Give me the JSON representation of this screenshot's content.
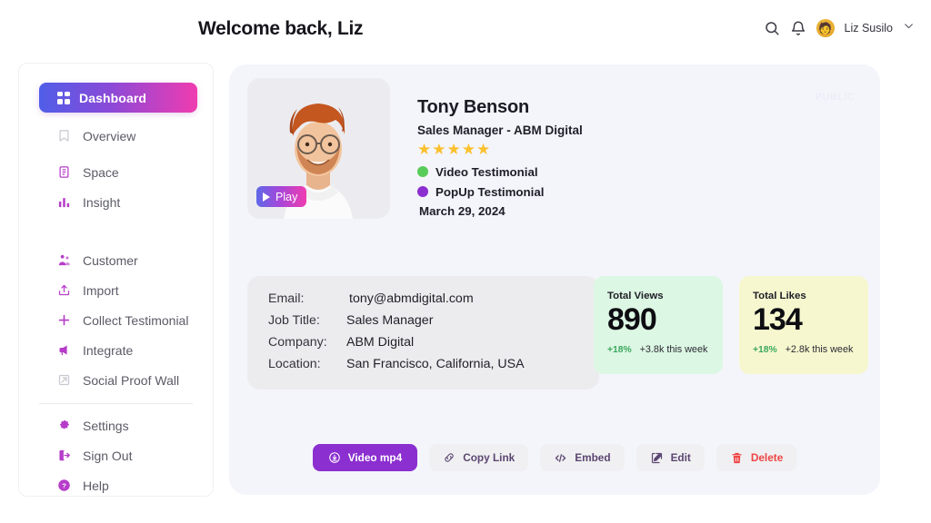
{
  "header": {
    "title": "Welcome back, Liz",
    "search_icon": "search-icon",
    "bell_icon": "bell-icon",
    "user_name": "Liz Susilo",
    "avatar_glyph": "🧑",
    "chevron_icon": "chevron-down-icon"
  },
  "sidebar": {
    "active": {
      "label": "Dashboard",
      "icon": "grid-icon"
    },
    "group1": [
      {
        "label": "Overview",
        "icon": "bookmark-icon"
      },
      {
        "label": "Space",
        "icon": "book-icon"
      },
      {
        "label": "Insight",
        "icon": "bar-chart-icon"
      }
    ],
    "group2": [
      {
        "label": "Customer",
        "icon": "users-icon"
      },
      {
        "label": "Import",
        "icon": "import-icon"
      },
      {
        "label": "Collect Testimonial",
        "icon": "plus-icon"
      },
      {
        "label": "Integrate",
        "icon": "megaphone-icon"
      },
      {
        "label": "Social Proof Wall",
        "icon": "external-link-icon"
      }
    ],
    "group3": [
      {
        "label": "Settings",
        "icon": "gear-icon"
      },
      {
        "label": "Sign Out",
        "icon": "logout-icon"
      },
      {
        "label": "Help",
        "icon": "help-circle-icon"
      }
    ]
  },
  "profile": {
    "ghost_badge": "PUBLIC",
    "play_label": "Play",
    "play_icon": "play-icon",
    "name": "Tony Benson",
    "role": "Sales Manager - ABM Digital",
    "stars": "★★★★★",
    "rating": 5,
    "badges": [
      {
        "label": "Video Testimonial",
        "color": "#58cc58"
      },
      {
        "label": "PopUp Testimonial",
        "color": "#8b2fd0"
      }
    ],
    "date": "March 29, 2024"
  },
  "details": {
    "rows": [
      {
        "key": "Email:",
        "value": "tony@abmdigital.com"
      },
      {
        "key": "Job Title:",
        "value": "Sales Manager"
      },
      {
        "key": "Company:",
        "value": "ABM Digital"
      },
      {
        "key": "Location:",
        "value": "San Francisco, California, USA"
      }
    ]
  },
  "stats": [
    {
      "label": "Total Views",
      "value": "890",
      "pct": "+18%",
      "note": "+3.8k this week",
      "bg": "#dcf7e3"
    },
    {
      "label": "Total Likes",
      "value": "134",
      "pct": "+18%",
      "note": "+2.8k this week",
      "bg": "#f7f7cf"
    }
  ],
  "actions": [
    {
      "label": "Video mp4",
      "icon": "download-circle-icon",
      "style": "primary"
    },
    {
      "label": "Copy Link",
      "icon": "link-icon",
      "style": "default"
    },
    {
      "label": "Embed",
      "icon": "code-icon",
      "style": "default"
    },
    {
      "label": "Edit",
      "icon": "edit-icon",
      "style": "default"
    },
    {
      "label": "Delete",
      "icon": "trash-icon",
      "style": "danger"
    }
  ],
  "colors": {
    "brand_start": "#4f5ee8",
    "brand_mid": "#8b49d8",
    "brand_end": "#f03cb0",
    "accent_purple": "#8b2fd0",
    "danger": "#ef4444",
    "panel_bg": "#f4f5fb"
  }
}
